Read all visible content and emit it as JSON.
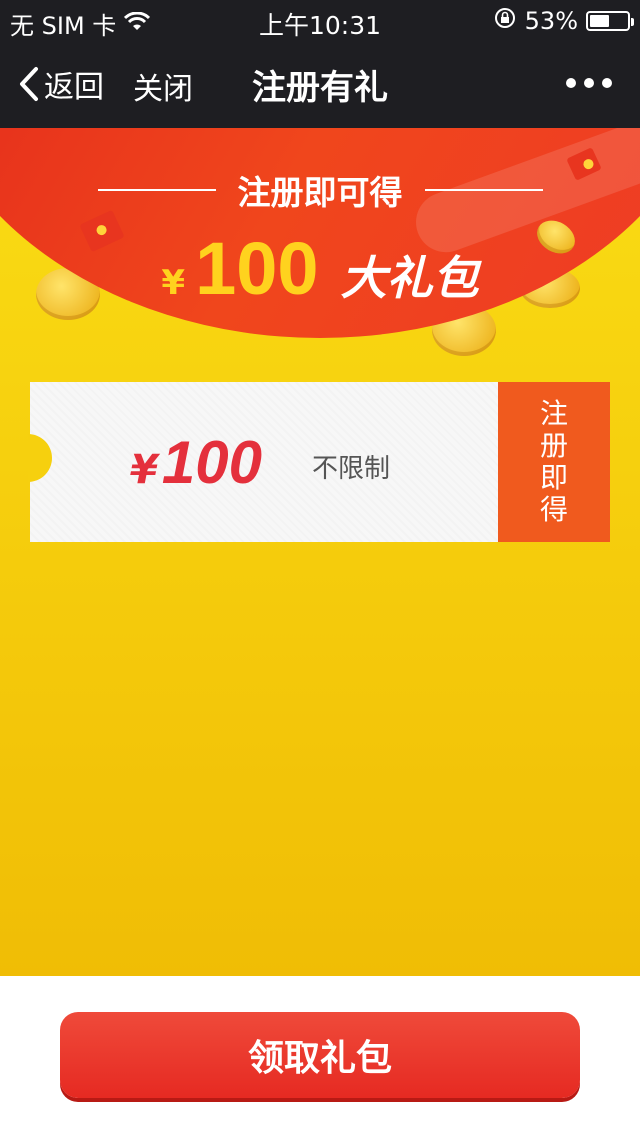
{
  "status_bar": {
    "carrier": "无 SIM 卡",
    "time": "上午10:31",
    "battery_percent": "53%",
    "battery_level": 0.53
  },
  "nav": {
    "back_label": "返回",
    "close_label": "关闭",
    "title": "注册有礼"
  },
  "banner": {
    "headline": "注册即可得",
    "currency": "¥",
    "amount": "100",
    "gift_text": "大礼包"
  },
  "coupon": {
    "currency": "¥",
    "amount": "100",
    "condition": "不限制",
    "action_label": "注册即得"
  },
  "bottom": {
    "claim_button": "领取礼包"
  },
  "colors": {
    "bar_bg": "#1e1e22",
    "banner_red": "#e0221c",
    "yellow_bg": "#f6d00e",
    "coupon_red": "#e4303c",
    "coupon_action_bg": "#f05a1e",
    "button_red": "#e62a22"
  }
}
